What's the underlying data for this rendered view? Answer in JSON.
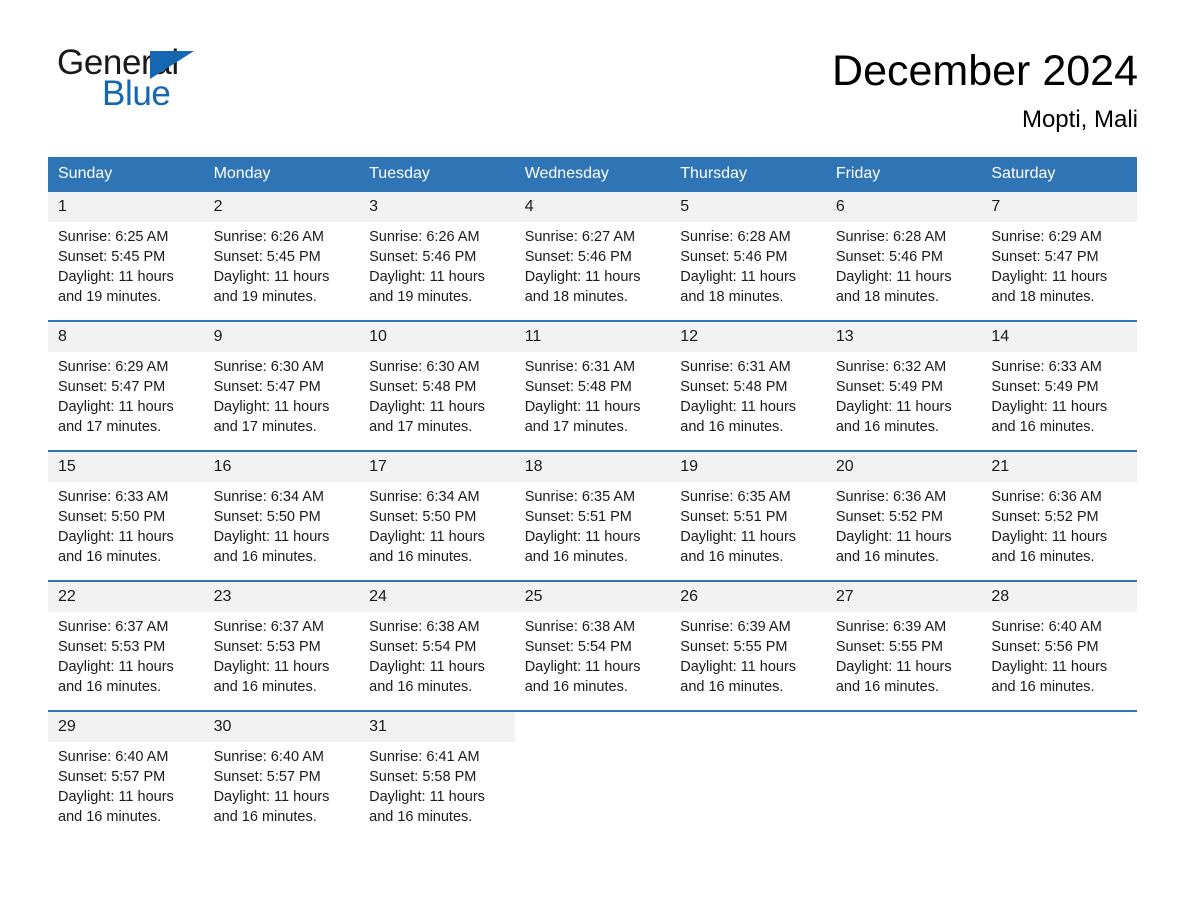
{
  "brand": {
    "name_part1": "General",
    "name_part2": "Blue",
    "accent_color": "#1567b2"
  },
  "header": {
    "title": "December 2024",
    "subtitle": "Mopti, Mali"
  },
  "theme": {
    "header_blue": "#2f74b5",
    "daynum_band": "#f2f2f2",
    "text": "#1a1a1a"
  },
  "calendar": {
    "weekday_headers": [
      "Sunday",
      "Monday",
      "Tuesday",
      "Wednesday",
      "Thursday",
      "Friday",
      "Saturday"
    ],
    "weeks": [
      {
        "days": [
          {
            "date": "1",
            "sunrise": "Sunrise: 6:25 AM",
            "sunset": "Sunset: 5:45 PM",
            "daylight": "Daylight: 11 hours and 19 minutes."
          },
          {
            "date": "2",
            "sunrise": "Sunrise: 6:26 AM",
            "sunset": "Sunset: 5:45 PM",
            "daylight": "Daylight: 11 hours and 19 minutes."
          },
          {
            "date": "3",
            "sunrise": "Sunrise: 6:26 AM",
            "sunset": "Sunset: 5:46 PM",
            "daylight": "Daylight: 11 hours and 19 minutes."
          },
          {
            "date": "4",
            "sunrise": "Sunrise: 6:27 AM",
            "sunset": "Sunset: 5:46 PM",
            "daylight": "Daylight: 11 hours and 18 minutes."
          },
          {
            "date": "5",
            "sunrise": "Sunrise: 6:28 AM",
            "sunset": "Sunset: 5:46 PM",
            "daylight": "Daylight: 11 hours and 18 minutes."
          },
          {
            "date": "6",
            "sunrise": "Sunrise: 6:28 AM",
            "sunset": "Sunset: 5:46 PM",
            "daylight": "Daylight: 11 hours and 18 minutes."
          },
          {
            "date": "7",
            "sunrise": "Sunrise: 6:29 AM",
            "sunset": "Sunset: 5:47 PM",
            "daylight": "Daylight: 11 hours and 18 minutes."
          }
        ]
      },
      {
        "days": [
          {
            "date": "8",
            "sunrise": "Sunrise: 6:29 AM",
            "sunset": "Sunset: 5:47 PM",
            "daylight": "Daylight: 11 hours and 17 minutes."
          },
          {
            "date": "9",
            "sunrise": "Sunrise: 6:30 AM",
            "sunset": "Sunset: 5:47 PM",
            "daylight": "Daylight: 11 hours and 17 minutes."
          },
          {
            "date": "10",
            "sunrise": "Sunrise: 6:30 AM",
            "sunset": "Sunset: 5:48 PM",
            "daylight": "Daylight: 11 hours and 17 minutes."
          },
          {
            "date": "11",
            "sunrise": "Sunrise: 6:31 AM",
            "sunset": "Sunset: 5:48 PM",
            "daylight": "Daylight: 11 hours and 17 minutes."
          },
          {
            "date": "12",
            "sunrise": "Sunrise: 6:31 AM",
            "sunset": "Sunset: 5:48 PM",
            "daylight": "Daylight: 11 hours and 16 minutes."
          },
          {
            "date": "13",
            "sunrise": "Sunrise: 6:32 AM",
            "sunset": "Sunset: 5:49 PM",
            "daylight": "Daylight: 11 hours and 16 minutes."
          },
          {
            "date": "14",
            "sunrise": "Sunrise: 6:33 AM",
            "sunset": "Sunset: 5:49 PM",
            "daylight": "Daylight: 11 hours and 16 minutes."
          }
        ]
      },
      {
        "days": [
          {
            "date": "15",
            "sunrise": "Sunrise: 6:33 AM",
            "sunset": "Sunset: 5:50 PM",
            "daylight": "Daylight: 11 hours and 16 minutes."
          },
          {
            "date": "16",
            "sunrise": "Sunrise: 6:34 AM",
            "sunset": "Sunset: 5:50 PM",
            "daylight": "Daylight: 11 hours and 16 minutes."
          },
          {
            "date": "17",
            "sunrise": "Sunrise: 6:34 AM",
            "sunset": "Sunset: 5:50 PM",
            "daylight": "Daylight: 11 hours and 16 minutes."
          },
          {
            "date": "18",
            "sunrise": "Sunrise: 6:35 AM",
            "sunset": "Sunset: 5:51 PM",
            "daylight": "Daylight: 11 hours and 16 minutes."
          },
          {
            "date": "19",
            "sunrise": "Sunrise: 6:35 AM",
            "sunset": "Sunset: 5:51 PM",
            "daylight": "Daylight: 11 hours and 16 minutes."
          },
          {
            "date": "20",
            "sunrise": "Sunrise: 6:36 AM",
            "sunset": "Sunset: 5:52 PM",
            "daylight": "Daylight: 11 hours and 16 minutes."
          },
          {
            "date": "21",
            "sunrise": "Sunrise: 6:36 AM",
            "sunset": "Sunset: 5:52 PM",
            "daylight": "Daylight: 11 hours and 16 minutes."
          }
        ]
      },
      {
        "days": [
          {
            "date": "22",
            "sunrise": "Sunrise: 6:37 AM",
            "sunset": "Sunset: 5:53 PM",
            "daylight": "Daylight: 11 hours and 16 minutes."
          },
          {
            "date": "23",
            "sunrise": "Sunrise: 6:37 AM",
            "sunset": "Sunset: 5:53 PM",
            "daylight": "Daylight: 11 hours and 16 minutes."
          },
          {
            "date": "24",
            "sunrise": "Sunrise: 6:38 AM",
            "sunset": "Sunset: 5:54 PM",
            "daylight": "Daylight: 11 hours and 16 minutes."
          },
          {
            "date": "25",
            "sunrise": "Sunrise: 6:38 AM",
            "sunset": "Sunset: 5:54 PM",
            "daylight": "Daylight: 11 hours and 16 minutes."
          },
          {
            "date": "26",
            "sunrise": "Sunrise: 6:39 AM",
            "sunset": "Sunset: 5:55 PM",
            "daylight": "Daylight: 11 hours and 16 minutes."
          },
          {
            "date": "27",
            "sunrise": "Sunrise: 6:39 AM",
            "sunset": "Sunset: 5:55 PM",
            "daylight": "Daylight: 11 hours and 16 minutes."
          },
          {
            "date": "28",
            "sunrise": "Sunrise: 6:40 AM",
            "sunset": "Sunset: 5:56 PM",
            "daylight": "Daylight: 11 hours and 16 minutes."
          }
        ]
      },
      {
        "days": [
          {
            "date": "29",
            "sunrise": "Sunrise: 6:40 AM",
            "sunset": "Sunset: 5:57 PM",
            "daylight": "Daylight: 11 hours and 16 minutes."
          },
          {
            "date": "30",
            "sunrise": "Sunrise: 6:40 AM",
            "sunset": "Sunset: 5:57 PM",
            "daylight": "Daylight: 11 hours and 16 minutes."
          },
          {
            "date": "31",
            "sunrise": "Sunrise: 6:41 AM",
            "sunset": "Sunset: 5:58 PM",
            "daylight": "Daylight: 11 hours and 16 minutes."
          },
          {
            "date": "",
            "sunrise": "",
            "sunset": "",
            "daylight": ""
          },
          {
            "date": "",
            "sunrise": "",
            "sunset": "",
            "daylight": ""
          },
          {
            "date": "",
            "sunrise": "",
            "sunset": "",
            "daylight": ""
          },
          {
            "date": "",
            "sunrise": "",
            "sunset": "",
            "daylight": ""
          }
        ]
      }
    ]
  }
}
